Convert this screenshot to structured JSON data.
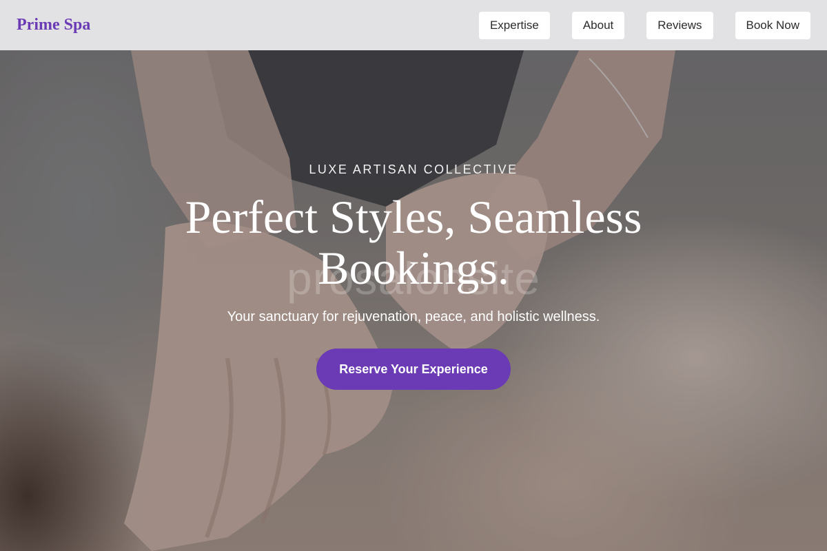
{
  "brand": {
    "name": "Prime Spa",
    "color": "#6a3bb5"
  },
  "nav": {
    "items": [
      {
        "label": "Expertise"
      },
      {
        "label": "About"
      },
      {
        "label": "Reviews"
      },
      {
        "label": "Book Now"
      }
    ]
  },
  "hero": {
    "kicker": "LUXE ARTISAN COLLECTIVE",
    "headline": "Perfect Styles, Seamless Bookings.",
    "subline": "Your sanctuary for rejuvenation, peace, and holistic wellness.",
    "cta_label": "Reserve Your Experience",
    "watermark": "prosalonsite"
  },
  "colors": {
    "accent": "#6a3bb5",
    "header_bg": "#ececee"
  }
}
